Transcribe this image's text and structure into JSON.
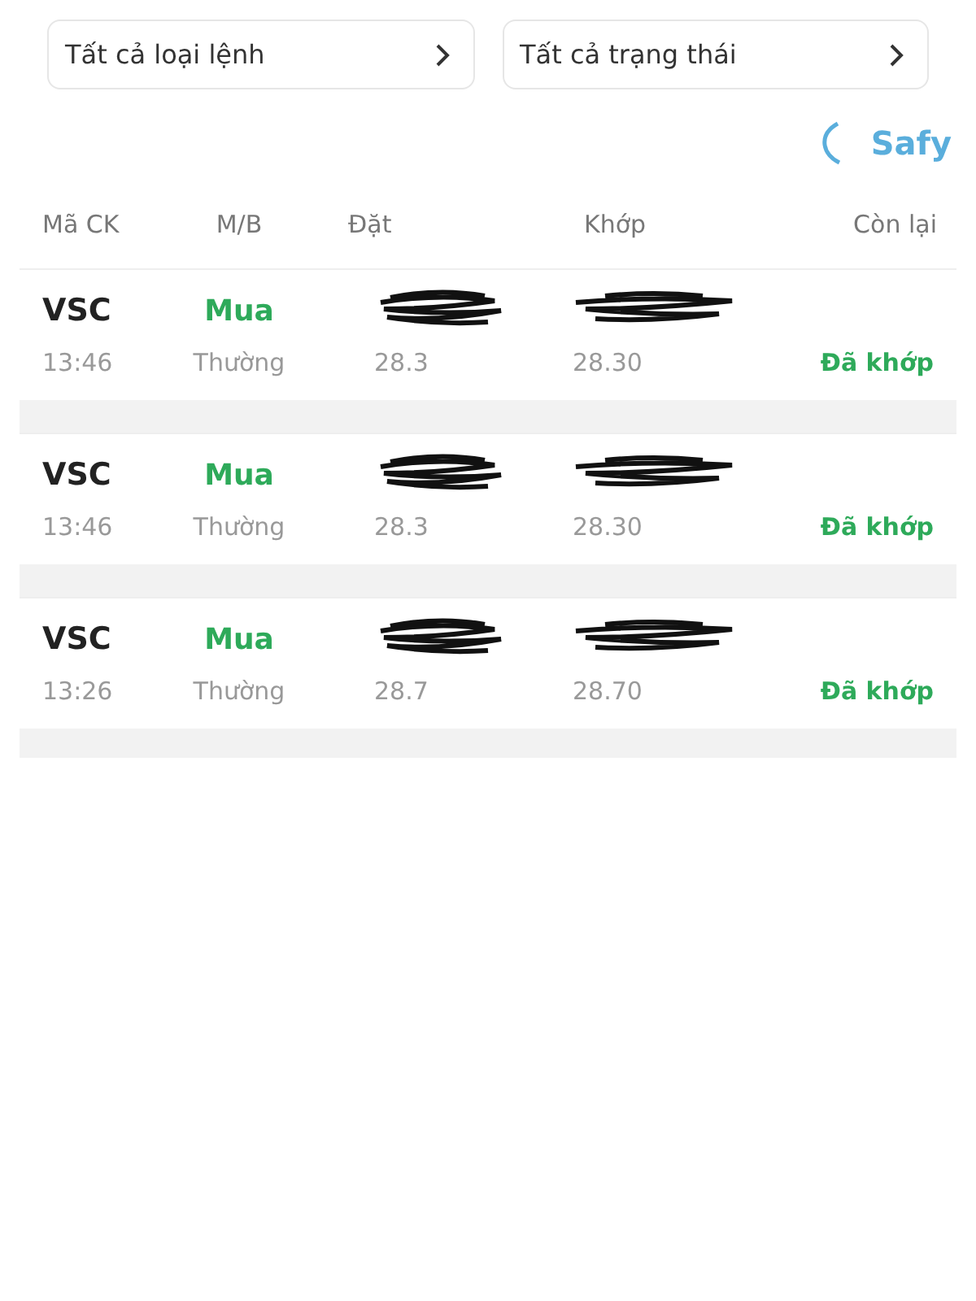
{
  "filters": [
    {
      "label": "Tất cả loại lệnh"
    },
    {
      "label": "Tất cả trạng thái"
    }
  ],
  "brand": {
    "name": "Safy"
  },
  "table": {
    "columns": [
      "Mã CK",
      "M/B",
      "Đặt",
      "Khớp",
      "Còn lại"
    ],
    "rows": [
      {
        "symbol": "VSC",
        "side": "Mua",
        "time": "13:46",
        "order_type": "Thường",
        "order_price": "28.3",
        "matched_price": "28.30",
        "status": "Đã khớp",
        "redacted": true
      },
      {
        "symbol": "VSC",
        "side": "Mua",
        "time": "13:46",
        "order_type": "Thường",
        "order_price": "28.3",
        "matched_price": "28.30",
        "status": "Đã khớp",
        "redacted": true
      },
      {
        "symbol": "VSC",
        "side": "Mua",
        "time": "13:26",
        "order_type": "Thường",
        "order_price": "28.7",
        "matched_price": "28.70",
        "status": "Đã khớp",
        "redacted": true
      }
    ]
  }
}
